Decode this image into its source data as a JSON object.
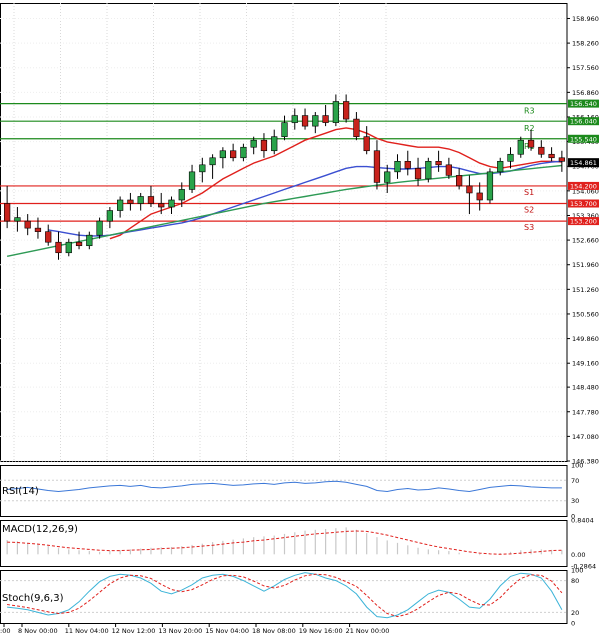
{
  "chart_data": [
    {
      "type": "candlestick",
      "title": "",
      "ylim": [
        146.38,
        159.4
      ],
      "y_ticks": [
        "158.960",
        "158.260",
        "157.560",
        "156.860",
        "156.160",
        "155.460",
        "154.760",
        "154.060",
        "153.360",
        "152.660",
        "151.960",
        "151.260",
        "150.560",
        "149.860",
        "149.160",
        "148.480",
        "147.780",
        "147.080",
        "146.380"
      ],
      "x_ticks": [
        ":00",
        "8 Nov 00:00",
        "11 Nov 04:00",
        "12 Nov 12:00",
        "13 Nov 20:00",
        "15 Nov 04:00",
        "18 Nov 08:00",
        "19 Nov 16:00",
        "21 Nov 00:00"
      ],
      "candles": [
        {
          "o": 153.7,
          "h": 154.2,
          "l": 153.0,
          "c": 153.2
        },
        {
          "o": 153.2,
          "h": 153.6,
          "l": 152.9,
          "c": 153.3
        },
        {
          "o": 153.2,
          "h": 153.4,
          "l": 152.8,
          "c": 153.0
        },
        {
          "o": 153.0,
          "h": 153.3,
          "l": 152.7,
          "c": 152.9
        },
        {
          "o": 152.9,
          "h": 153.1,
          "l": 152.5,
          "c": 152.6
        },
        {
          "o": 152.6,
          "h": 152.9,
          "l": 152.1,
          "c": 152.3
        },
        {
          "o": 152.3,
          "h": 152.7,
          "l": 152.2,
          "c": 152.6
        },
        {
          "o": 152.6,
          "h": 152.9,
          "l": 152.4,
          "c": 152.5
        },
        {
          "o": 152.5,
          "h": 152.9,
          "l": 152.4,
          "c": 152.8
        },
        {
          "o": 152.8,
          "h": 153.3,
          "l": 152.7,
          "c": 153.2
        },
        {
          "o": 153.2,
          "h": 153.6,
          "l": 153.0,
          "c": 153.5
        },
        {
          "o": 153.5,
          "h": 153.9,
          "l": 153.3,
          "c": 153.8
        },
        {
          "o": 153.8,
          "h": 154.0,
          "l": 153.5,
          "c": 153.7
        },
        {
          "o": 153.7,
          "h": 154.0,
          "l": 153.5,
          "c": 153.9
        },
        {
          "o": 153.9,
          "h": 154.2,
          "l": 153.6,
          "c": 153.7
        },
        {
          "o": 153.7,
          "h": 154.0,
          "l": 153.4,
          "c": 153.6
        },
        {
          "o": 153.6,
          "h": 153.9,
          "l": 153.4,
          "c": 153.8
        },
        {
          "o": 153.8,
          "h": 154.3,
          "l": 153.6,
          "c": 154.1
        },
        {
          "o": 154.1,
          "h": 154.8,
          "l": 154.0,
          "c": 154.6
        },
        {
          "o": 154.6,
          "h": 155.0,
          "l": 154.3,
          "c": 154.8
        },
        {
          "o": 154.8,
          "h": 155.1,
          "l": 154.4,
          "c": 155.0
        },
        {
          "o": 155.0,
          "h": 155.3,
          "l": 154.7,
          "c": 155.2
        },
        {
          "o": 155.2,
          "h": 155.4,
          "l": 154.9,
          "c": 155.0
        },
        {
          "o": 155.0,
          "h": 155.4,
          "l": 154.9,
          "c": 155.3
        },
        {
          "o": 155.3,
          "h": 155.6,
          "l": 155.1,
          "c": 155.5
        },
        {
          "o": 155.5,
          "h": 155.7,
          "l": 155.0,
          "c": 155.2
        },
        {
          "o": 155.2,
          "h": 155.8,
          "l": 155.1,
          "c": 155.6
        },
        {
          "o": 155.6,
          "h": 156.2,
          "l": 155.5,
          "c": 156.0
        },
        {
          "o": 156.0,
          "h": 156.4,
          "l": 155.8,
          "c": 156.2
        },
        {
          "o": 156.2,
          "h": 156.4,
          "l": 155.8,
          "c": 155.9
        },
        {
          "o": 155.9,
          "h": 156.3,
          "l": 155.7,
          "c": 156.2
        },
        {
          "o": 156.2,
          "h": 156.5,
          "l": 155.9,
          "c": 156.0
        },
        {
          "o": 156.0,
          "h": 156.8,
          "l": 155.9,
          "c": 156.6
        },
        {
          "o": 156.6,
          "h": 156.8,
          "l": 156.0,
          "c": 156.1
        },
        {
          "o": 156.1,
          "h": 156.3,
          "l": 155.5,
          "c": 155.6
        },
        {
          "o": 155.6,
          "h": 155.9,
          "l": 155.1,
          "c": 155.2
        },
        {
          "o": 155.2,
          "h": 155.5,
          "l": 154.1,
          "c": 154.3
        },
        {
          "o": 154.3,
          "h": 154.8,
          "l": 154.0,
          "c": 154.6
        },
        {
          "o": 154.6,
          "h": 155.1,
          "l": 154.4,
          "c": 154.9
        },
        {
          "o": 154.9,
          "h": 155.2,
          "l": 154.5,
          "c": 154.7
        },
        {
          "o": 154.7,
          "h": 155.0,
          "l": 154.2,
          "c": 154.4
        },
        {
          "o": 154.4,
          "h": 155.0,
          "l": 154.3,
          "c": 154.9
        },
        {
          "o": 154.9,
          "h": 155.2,
          "l": 154.6,
          "c": 154.8
        },
        {
          "o": 154.8,
          "h": 155.0,
          "l": 154.4,
          "c": 154.5
        },
        {
          "o": 154.5,
          "h": 154.7,
          "l": 154.1,
          "c": 154.2
        },
        {
          "o": 154.2,
          "h": 154.5,
          "l": 153.4,
          "c": 154.0
        },
        {
          "o": 154.0,
          "h": 154.3,
          "l": 153.5,
          "c": 153.8
        },
        {
          "o": 153.8,
          "h": 154.7,
          "l": 153.7,
          "c": 154.6
        },
        {
          "o": 154.6,
          "h": 155.0,
          "l": 154.5,
          "c": 154.9
        },
        {
          "o": 154.9,
          "h": 155.3,
          "l": 154.7,
          "c": 155.1
        },
        {
          "o": 155.1,
          "h": 155.6,
          "l": 155.0,
          "c": 155.5
        },
        {
          "o": 155.5,
          "h": 155.8,
          "l": 155.2,
          "c": 155.3
        },
        {
          "o": 155.3,
          "h": 155.5,
          "l": 155.0,
          "c": 155.1
        },
        {
          "o": 155.1,
          "h": 155.3,
          "l": 154.9,
          "c": 155.0
        },
        {
          "o": 155.0,
          "h": 155.2,
          "l": 154.6,
          "c": 154.9
        }
      ],
      "series": [
        {
          "color": "#e0201c",
          "values": [
            null,
            null,
            null,
            null,
            null,
            null,
            null,
            null,
            null,
            null,
            152.7,
            152.8,
            153.0,
            153.2,
            153.4,
            153.5,
            153.6,
            153.7,
            153.85,
            154.0,
            154.2,
            154.4,
            154.55,
            154.7,
            154.85,
            154.95,
            155.05,
            155.2,
            155.35,
            155.5,
            155.6,
            155.7,
            155.8,
            155.85,
            155.8,
            155.7,
            155.55,
            155.45,
            155.4,
            155.35,
            155.3,
            155.3,
            155.3,
            155.25,
            155.15,
            155.0,
            154.85,
            154.75,
            154.7,
            154.75,
            154.8,
            154.85,
            154.9,
            154.9,
            154.88
          ]
        },
        {
          "color": "#3b4fd1",
          "values": [
            null,
            null,
            null,
            null,
            152.95,
            152.9,
            152.85,
            152.8,
            152.78,
            152.78,
            152.8,
            152.85,
            152.9,
            152.95,
            153.0,
            153.05,
            153.1,
            153.15,
            153.22,
            153.3,
            153.4,
            153.5,
            153.6,
            153.7,
            153.8,
            153.9,
            154.0,
            154.1,
            154.2,
            154.3,
            154.4,
            154.5,
            154.6,
            154.7,
            154.75,
            154.75,
            154.72,
            154.7,
            154.68,
            154.68,
            154.7,
            154.72,
            154.75,
            154.75,
            154.7,
            154.62,
            154.55,
            154.55,
            154.58,
            154.62,
            154.7,
            154.78,
            154.84,
            154.88,
            154.9
          ]
        },
        {
          "color": "#2e9a55",
          "values": [
            152.2,
            152.26,
            152.32,
            152.38,
            152.44,
            152.5,
            152.56,
            152.62,
            152.68,
            152.74,
            152.8,
            152.86,
            152.92,
            152.98,
            153.04,
            153.1,
            153.16,
            153.22,
            153.28,
            153.34,
            153.4,
            153.46,
            153.52,
            153.58,
            153.64,
            153.7,
            153.75,
            153.8,
            153.85,
            153.9,
            153.95,
            154.0,
            154.05,
            154.1,
            154.14,
            154.18,
            154.22,
            154.26,
            154.3,
            154.33,
            154.36,
            154.39,
            154.42,
            154.45,
            154.48,
            154.51,
            154.54,
            154.57,
            154.6,
            154.63,
            154.66,
            154.69,
            154.72,
            154.75,
            154.78
          ]
        }
      ],
      "levels": [
        {
          "name": "R3",
          "value": 156.54,
          "label": "156.540",
          "color": "#1c8a1c"
        },
        {
          "name": "R2",
          "value": 156.04,
          "label": "156.040",
          "color": "#1c8a1c"
        },
        {
          "name": "R1",
          "value": 155.54,
          "label": "155.540",
          "color": "#1c8a1c"
        },
        {
          "name": "S1",
          "value": 154.2,
          "label": "154.200",
          "color": "#e0201c"
        },
        {
          "name": "S2",
          "value": 153.7,
          "label": "153.700",
          "color": "#e0201c"
        },
        {
          "name": "S3",
          "value": 153.2,
          "label": "153.200",
          "color": "#e0201c"
        }
      ],
      "current_price": "154.861"
    },
    {
      "type": "line",
      "name": "RSI(14)",
      "title": "RSI(14)",
      "ylim": [
        0,
        100
      ],
      "y_ticks": [
        "100",
        "70",
        "30",
        "0"
      ],
      "color": "#3c78d8",
      "values": [
        52,
        54,
        56,
        53,
        50,
        48,
        50,
        52,
        55,
        57,
        59,
        60,
        58,
        60,
        56,
        55,
        57,
        59,
        62,
        63,
        64,
        62,
        60,
        61,
        63,
        64,
        62,
        65,
        66,
        64,
        65,
        67,
        68,
        66,
        62,
        58,
        50,
        48,
        52,
        54,
        51,
        52,
        55,
        53,
        50,
        48,
        52,
        56,
        58,
        60,
        59,
        57,
        56,
        55,
        55
      ]
    },
    {
      "type": "bar+line",
      "name": "MACD(12,26,9)",
      "title": "MACD(12,26,9)",
      "ylim": [
        -0.2864,
        0.8404
      ],
      "y_ticks": [
        "0.8404",
        "0.00",
        "-0.2864"
      ],
      "histogram": [
        0.35,
        0.32,
        0.28,
        0.25,
        0.2,
        0.15,
        0.12,
        0.1,
        0.08,
        0.06,
        0.08,
        0.1,
        0.12,
        0.14,
        0.16,
        0.17,
        0.18,
        0.2,
        0.23,
        0.26,
        0.3,
        0.33,
        0.36,
        0.39,
        0.42,
        0.44,
        0.46,
        0.5,
        0.54,
        0.58,
        0.6,
        0.62,
        0.64,
        0.66,
        0.6,
        0.52,
        0.42,
        0.34,
        0.28,
        0.22,
        0.16,
        0.12,
        0.1,
        0.08,
        0.04,
        0.0,
        -0.02,
        0.0,
        0.03,
        0.06,
        0.1,
        0.12,
        0.12,
        0.11,
        0.1
      ],
      "signal": [
        0.3,
        0.29,
        0.27,
        0.25,
        0.22,
        0.19,
        0.16,
        0.14,
        0.12,
        0.1,
        0.09,
        0.09,
        0.1,
        0.11,
        0.12,
        0.14,
        0.15,
        0.16,
        0.18,
        0.2,
        0.22,
        0.25,
        0.28,
        0.3,
        0.33,
        0.35,
        0.38,
        0.41,
        0.44,
        0.47,
        0.5,
        0.52,
        0.54,
        0.56,
        0.57,
        0.56,
        0.52,
        0.47,
        0.41,
        0.35,
        0.29,
        0.23,
        0.18,
        0.14,
        0.1,
        0.06,
        0.03,
        0.01,
        0.0,
        0.01,
        0.03,
        0.05,
        0.07,
        0.09,
        0.1
      ],
      "signal_color": "#e0201c",
      "histogram_color": "#c8c8c8"
    },
    {
      "type": "line",
      "name": "Stoch(9,6,3)",
      "title": "Stoch(9,6,3)",
      "ylim": [
        0,
        100
      ],
      "y_ticks": [
        "100",
        "80",
        "20",
        "0"
      ],
      "series": [
        {
          "color": "#3cb4d8",
          "values": [
            30,
            28,
            25,
            20,
            15,
            18,
            25,
            40,
            60,
            78,
            88,
            92,
            90,
            85,
            75,
            60,
            55,
            62,
            72,
            85,
            90,
            92,
            88,
            80,
            70,
            60,
            70,
            82,
            90,
            95,
            92,
            85,
            80,
            70,
            55,
            30,
            12,
            10,
            15,
            25,
            40,
            55,
            62,
            58,
            45,
            30,
            28,
            45,
            70,
            88,
            94,
            92,
            85,
            60,
            25
          ]
        },
        {
          "color": "#e0201c",
          "values": [
            35,
            32,
            29,
            25,
            21,
            18,
            20,
            28,
            42,
            58,
            74,
            85,
            90,
            89,
            84,
            73,
            63,
            59,
            63,
            72,
            82,
            89,
            90,
            87,
            79,
            70,
            66,
            71,
            81,
            89,
            92,
            91,
            86,
            78,
            69,
            52,
            33,
            18,
            12,
            17,
            27,
            40,
            52,
            58,
            55,
            44,
            35,
            34,
            48,
            68,
            84,
            91,
            90,
            79,
            57
          ]
        }
      ]
    }
  ]
}
